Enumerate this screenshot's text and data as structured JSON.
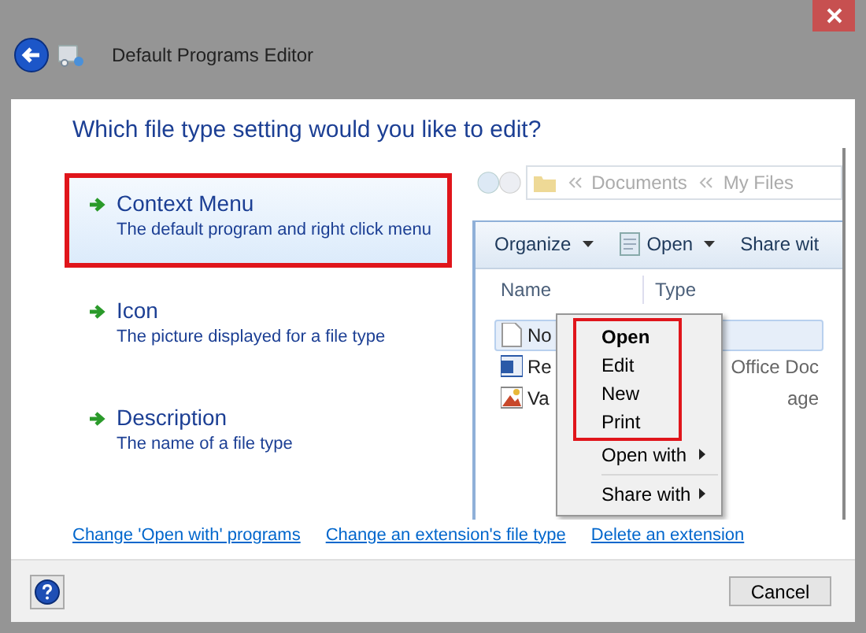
{
  "window": {
    "title": "Default Programs Editor"
  },
  "heading": "Which file type setting would you like to edit?",
  "options": [
    {
      "title": "Context Menu",
      "description": "The default program and right click menu",
      "selected": true
    },
    {
      "title": "Icon",
      "description": "The picture displayed for a file type",
      "selected": false
    },
    {
      "title": "Description",
      "description": "The name of a file type",
      "selected": false
    }
  ],
  "preview": {
    "address": [
      "Documents",
      "My Files"
    ],
    "toolbar": [
      {
        "label": "Organize",
        "dropdown": true,
        "kind": "plain"
      },
      {
        "label": "Open",
        "dropdown": true,
        "kind": "notepad"
      },
      {
        "label": "Share wit",
        "dropdown": false,
        "kind": "plain"
      }
    ],
    "columns": [
      "Name",
      "Type"
    ],
    "rows": [
      {
        "name": "No",
        "type": "",
        "kind": "text",
        "selected": true
      },
      {
        "name": "Re",
        "type": "Office Doc",
        "kind": "word",
        "selected": false
      },
      {
        "name": "Va",
        "type": "age",
        "kind": "image",
        "selected": false
      }
    ],
    "menu": [
      {
        "kind": "item",
        "label": "Open",
        "bold": true,
        "submenu": false,
        "boxed": true
      },
      {
        "kind": "item",
        "label": "Edit",
        "bold": false,
        "submenu": false,
        "boxed": true
      },
      {
        "kind": "item",
        "label": "New",
        "bold": false,
        "submenu": false,
        "boxed": true
      },
      {
        "kind": "item",
        "label": "Print",
        "bold": false,
        "submenu": false,
        "boxed": true
      },
      {
        "kind": "item",
        "label": "Open with",
        "bold": false,
        "submenu": true,
        "boxed": false
      },
      {
        "kind": "separator"
      },
      {
        "kind": "item",
        "label": "Share with",
        "bold": false,
        "submenu": true,
        "boxed": false
      }
    ]
  },
  "links": [
    "Change 'Open with' programs",
    "Change an extension's file type",
    "Delete an extension"
  ],
  "buttons": [
    "Cancel"
  ]
}
